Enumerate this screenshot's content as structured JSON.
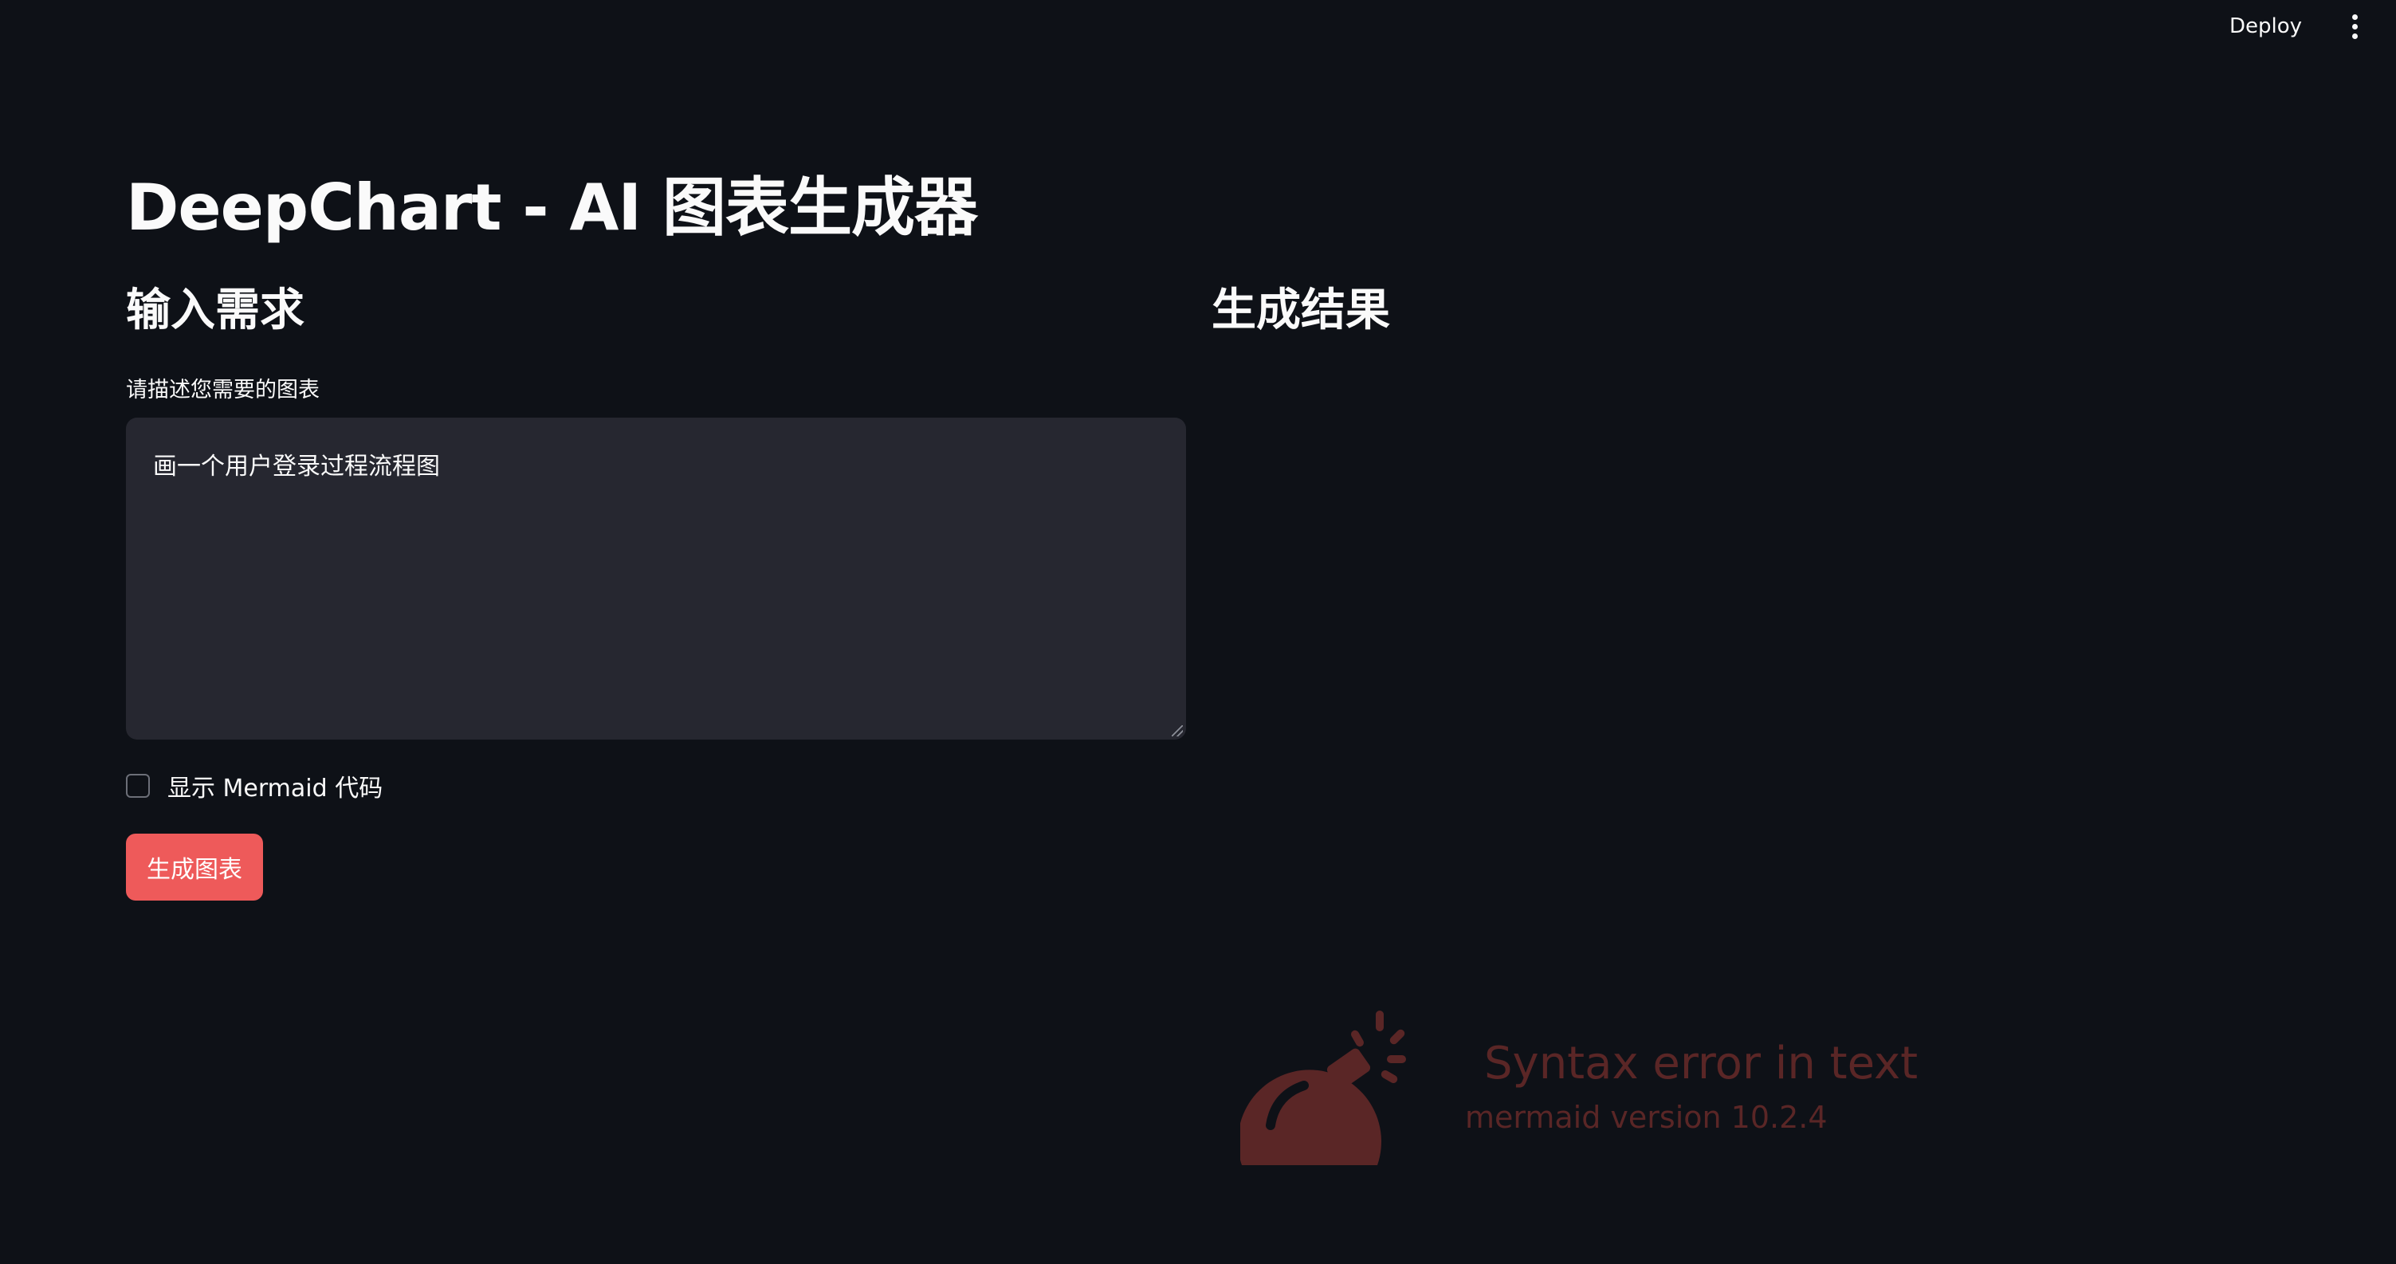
{
  "header": {
    "deploy_label": "Deploy",
    "menu_icon": "kebab-menu-icon"
  },
  "page": {
    "title": "DeepChart - AI 图表生成器"
  },
  "input_section": {
    "heading": "输入需求",
    "field_label": "请描述您需要的图表",
    "textarea_value": "画一个用户登录过程流程图",
    "checkbox_label": "显示 Mermaid 代码",
    "checkbox_checked": false,
    "generate_button_label": "生成图表"
  },
  "result_section": {
    "heading": "生成结果",
    "error": {
      "icon": "bomb-icon",
      "title": "Syntax error in text",
      "version": "mermaid version 10.2.4"
    }
  },
  "colors": {
    "background": "#0e1117",
    "input_background": "#262730",
    "primary_button": "#ee5a5a",
    "error_text": "#5a2626"
  }
}
